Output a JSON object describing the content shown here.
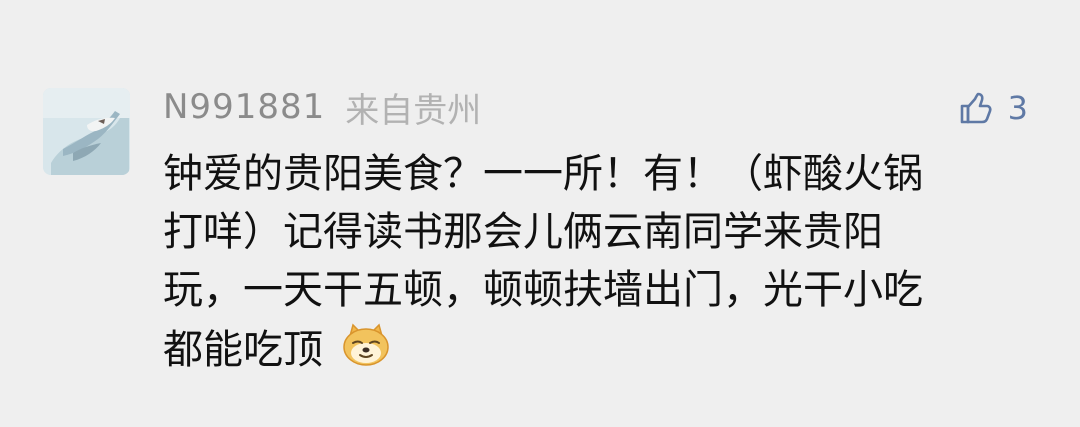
{
  "comment": {
    "username": "N991881",
    "location": "来自贵州",
    "like_count": "3",
    "avatar_icon": "avatar-image",
    "like_icon": "thumbs-up-icon",
    "emoji_icon": "doge-emoji-icon",
    "lines": [
      "钟爱的贵阳美食？一一所！有！（虾酸火锅",
      "打咩）记得读书那会儿俩云南同学来贵阳",
      "玩，一天干五顿，顿顿扶墙出门，光干小吃",
      "都能吃顶"
    ],
    "colors": {
      "background": "#efefef",
      "username": "#8b8b8b",
      "location": "#b2b2b2",
      "text": "#111111",
      "like": "#5f79a5"
    }
  }
}
